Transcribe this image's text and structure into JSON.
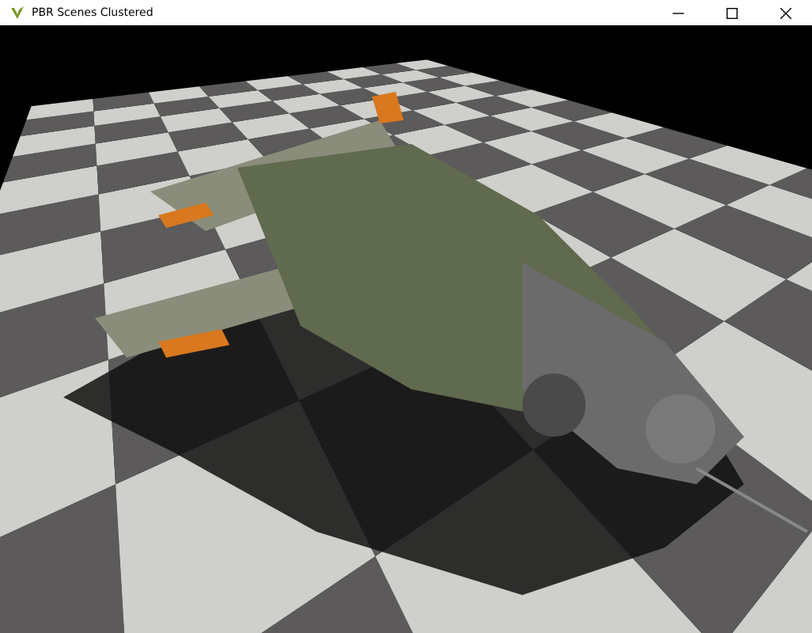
{
  "window": {
    "title": "PBR Scenes Clustered"
  }
}
